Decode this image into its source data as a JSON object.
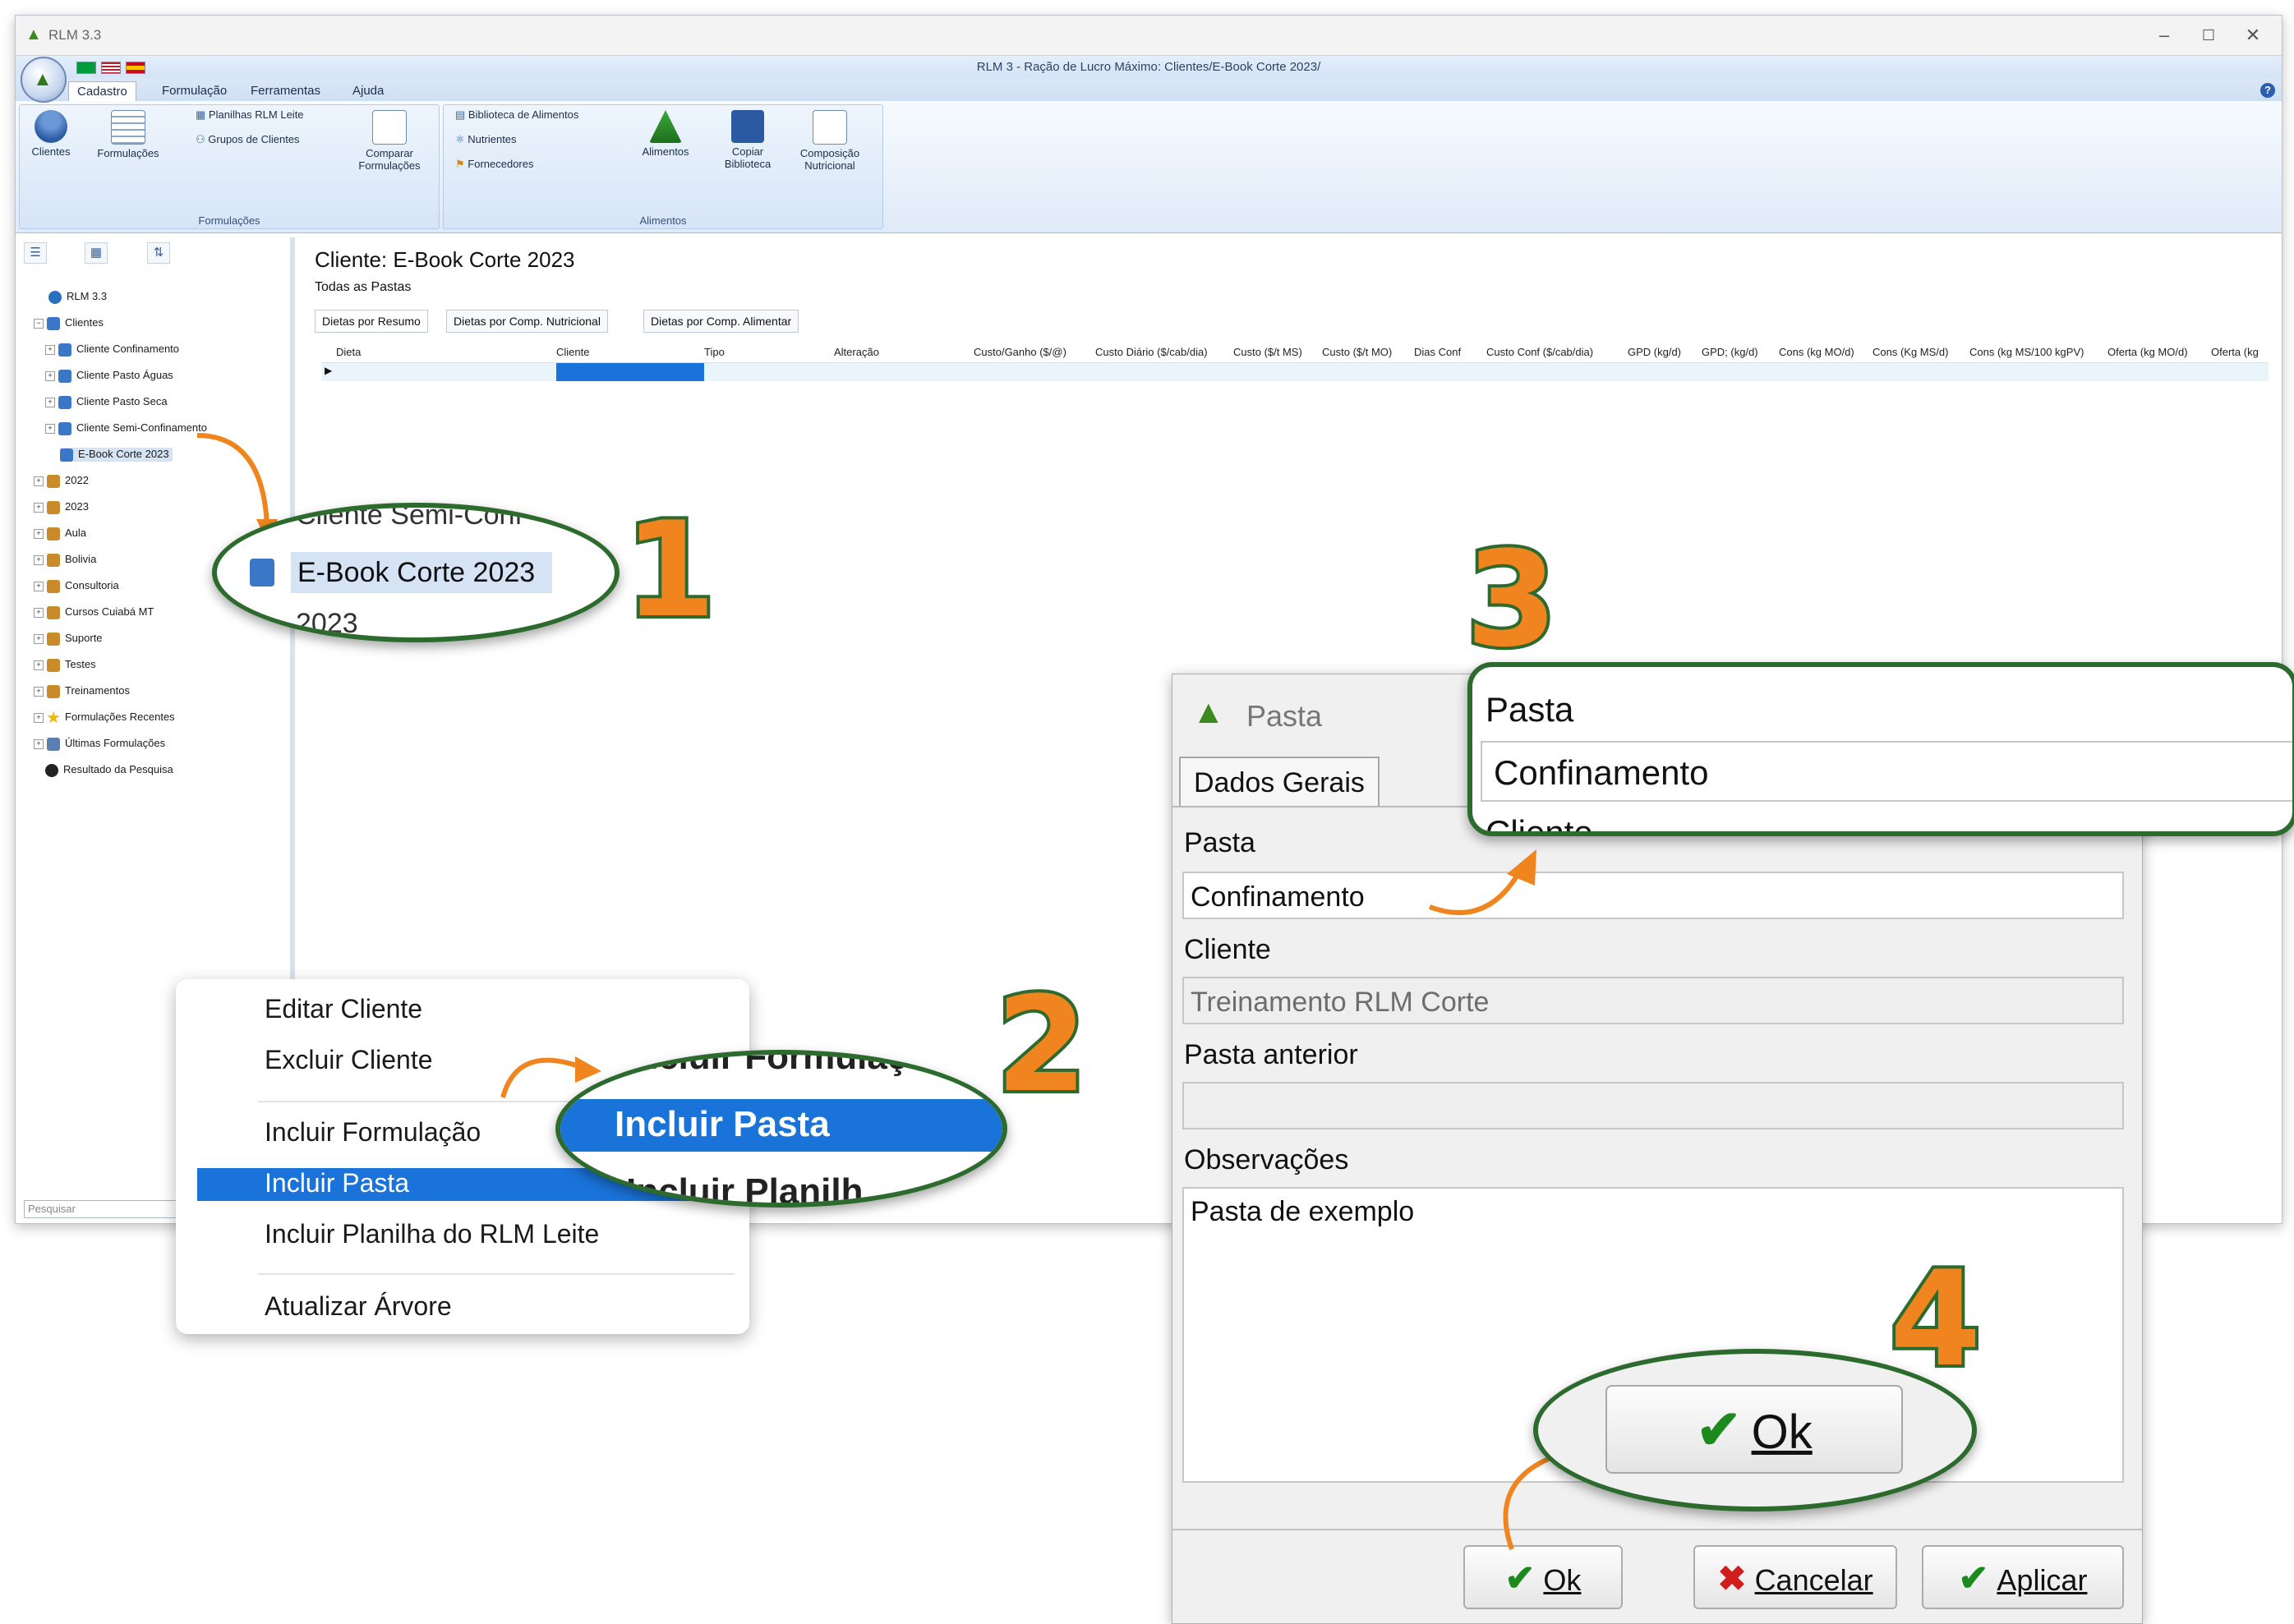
{
  "window": {
    "app_name": "RLM 3.3",
    "title": "RLM 3 - Ração de Lucro Máximo: Clientes/E-Book Corte 2023/",
    "min_icon": "–",
    "max_icon": "☐",
    "close_icon": "✕"
  },
  "ribbon": {
    "tabs": [
      "Cadastro",
      "Formulação",
      "Ferramentas",
      "Ajuda"
    ],
    "active_tab": "Cadastro",
    "groups": {
      "formulacoes": {
        "label": "Formulações",
        "clientes": "Clientes",
        "formulacoes": "Formulações",
        "planilhas": "Planilhas RLM Leite",
        "grupos": "Grupos de Clientes",
        "comparar_1": "Comparar",
        "comparar_2": "Formulações"
      },
      "alimentos": {
        "label": "Alimentos",
        "biblioteca": "Biblioteca de Alimentos",
        "nutrientes": "Nutrientes",
        "fornecedores": "Fornecedores",
        "alimentos": "Alimentos",
        "copiar_1": "Copiar",
        "copiar_2": "Biblioteca",
        "composicao_1": "Composição",
        "composicao_2": "Nutricional"
      }
    },
    "help": "?"
  },
  "tree": {
    "root": "RLM 3.3",
    "clientes": "Clientes",
    "children": [
      "Cliente Confinamento",
      "Cliente Pasto Águas",
      "Cliente Pasto Seca",
      "Cliente Semi-Confinamento",
      "E-Book Corte 2023"
    ],
    "folders": [
      "2022",
      "2023",
      "Aula",
      "Bolivia",
      "Consultoria",
      "Cursos Cuiabá MT",
      "Suporte",
      "Testes",
      "Treinamentos",
      "Formulações Recentes",
      "Últimas Formulações",
      "Resultado da Pesquisa"
    ],
    "search_placeholder": "Pesquisar"
  },
  "content": {
    "title": "Cliente: E-Book Corte 2023",
    "subtitle": "Todas as Pastas",
    "tabs": [
      "Dietas por Resumo",
      "Dietas por Comp. Nutricional",
      "Dietas por Comp. Alimentar"
    ],
    "columns": [
      "Dieta",
      "Cliente",
      "Tipo",
      "Alteração",
      "Custo/Ganho ($/@)",
      "Custo Diário ($/cab/dia)",
      "Custo ($/t MS)",
      "Custo ($/t MO)",
      "Dias Conf",
      "Custo Conf ($/cab/dia)",
      "GPD (kg/d)",
      "GPD; (kg/d)",
      "Cons (kg MO/d)",
      "Cons (Kg MS/d)",
      "Cons (kg MS/100 kgPV)",
      "Oferta (kg MO/d)",
      "Oferta (kg"
    ]
  },
  "callout1": {
    "number": "1",
    "partial_above": "Cliente Semi-Conf",
    "item": "E-Book Corte 2023",
    "partial_below": "2023"
  },
  "context_menu": {
    "items": [
      "Editar Cliente",
      "Excluir Cliente",
      "Incluir Formulação",
      "Incluir Pasta",
      "Incluir Planilha do RLM Leite",
      "Atualizar Árvore"
    ],
    "highlighted": "Incluir Pasta"
  },
  "callout2": {
    "number": "2",
    "partial_above": "Incluir Formulaç",
    "item": "Incluir Pasta",
    "partial_below": "Incluir Planilh"
  },
  "dialog": {
    "title": "Pasta",
    "tab": "Dados Gerais",
    "pasta_label": "Pasta",
    "pasta_value": "Confinamento",
    "cliente_label": "Cliente",
    "cliente_value": "Treinamento RLM Corte",
    "anterior_label": "Pasta anterior",
    "anterior_value": "",
    "obs_label": "Observações",
    "obs_value": "Pasta de exemplo",
    "ok": "Ok",
    "cancelar": "Cancelar",
    "aplicar": "Aplicar"
  },
  "callout3": {
    "number": "3",
    "label": "Pasta",
    "value": "Confinamento",
    "partial_below": "Cliente"
  },
  "callout4": {
    "number": "4",
    "ok": "Ok"
  },
  "colors": {
    "callout_green": "#2c6b2d",
    "callout_orange": "#f0841f",
    "selection_blue": "#1a73d9"
  }
}
